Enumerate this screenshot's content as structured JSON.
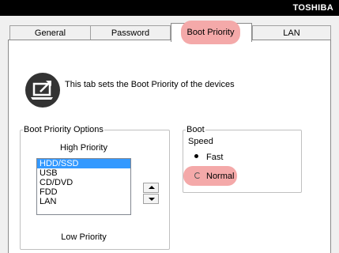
{
  "brand": "TOSHIBA",
  "tabs": [
    {
      "label": "General"
    },
    {
      "label": "Password"
    },
    {
      "label": "Boot Priority"
    },
    {
      "label": "LAN"
    }
  ],
  "info_text": "This tab sets the Boot Priority of the devices",
  "boot_options": {
    "legend": "Boot Priority Options",
    "high_label": "High Priority",
    "low_label": "Low Priority",
    "items": [
      "HDD/SSD",
      "USB",
      "CD/DVD",
      "FDD",
      "LAN"
    ],
    "selected": "HDD/SSD"
  },
  "boot": {
    "legend": "Boot",
    "speed_label": "Speed",
    "fast_label": "Fast",
    "normal_label": "Normal",
    "selected": "Fast"
  },
  "colors": {
    "highlight": "#f4a9a9",
    "list_selection": "#3399ff"
  },
  "icons": {
    "info": "external-link-laptop-icon",
    "up": "arrow-up-icon",
    "down": "arrow-down-icon"
  }
}
